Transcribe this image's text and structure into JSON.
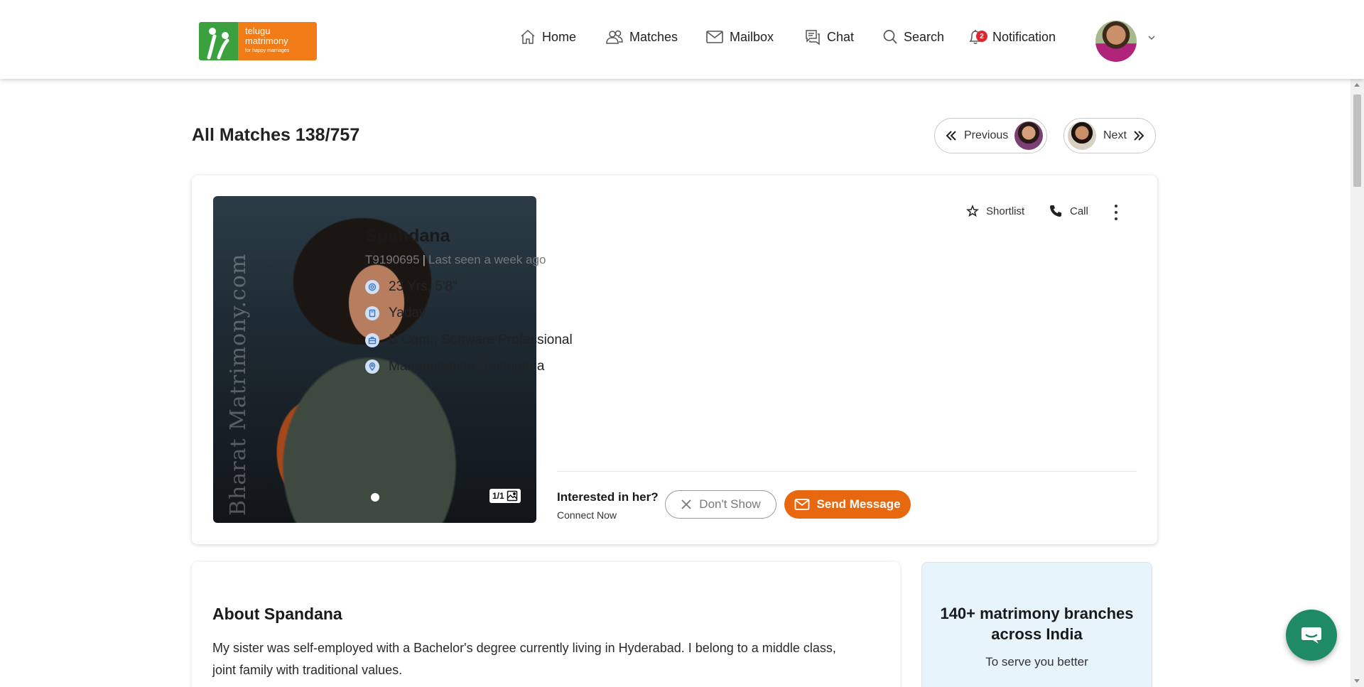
{
  "logo": {
    "line1": "telugu",
    "line2": "matrimony",
    "tagline": "for happy marriages"
  },
  "nav": {
    "home": "Home",
    "matches": "Matches",
    "mailbox": "Mailbox",
    "chat": "Chat",
    "search": "Search",
    "notification": "Notification",
    "notification_count": "2"
  },
  "page": {
    "title": "All Matches 138/757",
    "previous": "Previous",
    "next": "Next"
  },
  "profile": {
    "name": "Spandana",
    "id": "T9190695",
    "last_seen": "Last seen a week ago",
    "age_height": "23 Yrs, 5'8\"",
    "community": "Yadav",
    "education_job": "B.Com., Software Professional",
    "location": "Mahabubabad, Telangana",
    "photo_watermark": "Bharat Matrimony.com",
    "photo_count": "1/1"
  },
  "actions": {
    "shortlist": "Shortlist",
    "call": "Call",
    "interest_question": "Interested in her?",
    "interest_sub": "Connect Now",
    "dont_show": "Don't Show",
    "send_message": "Send Message"
  },
  "about": {
    "title": "About Spandana",
    "text": "My sister was self-employed with a Bachelor's degree currently living in Hyderabad. I belong to a middle class, joint family with traditional values."
  },
  "branches": {
    "title": "140+ matrimony branches across India",
    "subtitle": "To serve you better"
  },
  "colors": {
    "brand_orange": "#e8680f",
    "brand_green": "#3aa13e",
    "chat_green": "#1e8a66",
    "badge_red": "#e0262d"
  }
}
